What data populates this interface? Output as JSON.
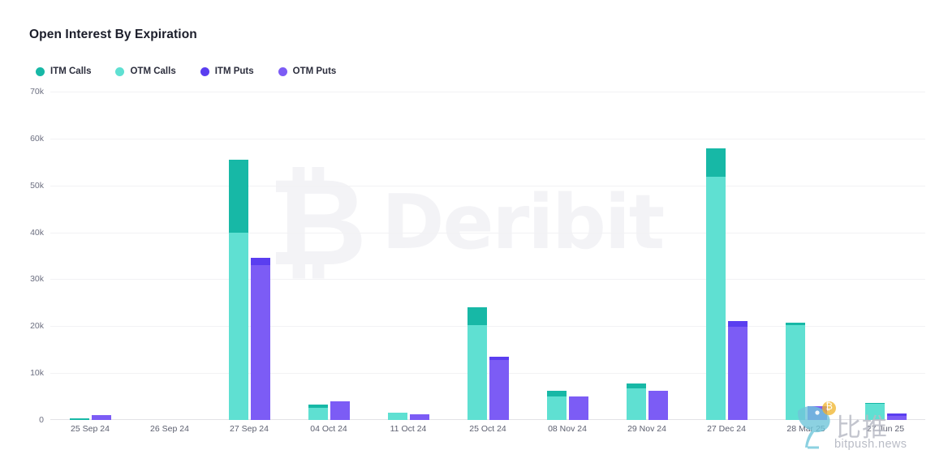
{
  "header": {
    "title": "Open Interest By Expiration"
  },
  "legend": [
    {
      "label": "ITM Calls",
      "color": "#17b8a6"
    },
    {
      "label": "OTM Calls",
      "color": "#5fe0d2"
    },
    {
      "label": "ITM Puts",
      "color": "#5a3ef0"
    },
    {
      "label": "OTM Puts",
      "color": "#7c5cf5"
    }
  ],
  "watermark": {
    "brand": "Deribit",
    "btc_glyph": "₿",
    "bitpush_cn": "比推",
    "bitpush_url": "bitpush.news"
  },
  "chart_data": {
    "type": "bar",
    "title": "Open Interest By Expiration",
    "xlabel": "",
    "ylabel": "",
    "ylim": [
      0,
      70000
    ],
    "ytick_labels": [
      "0",
      "10k",
      "20k",
      "30k",
      "40k",
      "50k",
      "60k",
      "70k"
    ],
    "ytick_values": [
      0,
      10000,
      20000,
      30000,
      40000,
      50000,
      60000,
      70000
    ],
    "grid": true,
    "legend_position": "top-left",
    "stacked": true,
    "grouped": true,
    "categories": [
      "25 Sep 24",
      "26 Sep 24",
      "27 Sep 24",
      "04 Oct 24",
      "11 Oct 24",
      "25 Oct 24",
      "08 Nov 24",
      "29 Nov 24",
      "27 Dec 24",
      "28 Mar 25",
      "27 Jun 25"
    ],
    "series": [
      {
        "name": "OTM Calls",
        "stack": "calls",
        "color": "#5fe0d2",
        "values": [
          0,
          0,
          40000,
          2600,
          1500,
          20300,
          5100,
          6700,
          51800,
          20200,
          3500
        ]
      },
      {
        "name": "ITM Calls",
        "stack": "calls",
        "color": "#17b8a6",
        "values": [
          400,
          0,
          15500,
          700,
          0,
          3700,
          1100,
          1000,
          6100,
          500,
          100
        ]
      },
      {
        "name": "OTM Puts",
        "stack": "puts",
        "color": "#7c5cf5",
        "values": [
          1000,
          0,
          33000,
          4000,
          1200,
          12800,
          5000,
          6200,
          19800,
          3000,
          900
        ]
      },
      {
        "name": "ITM Puts",
        "stack": "puts",
        "color": "#5a3ef0",
        "values": [
          0,
          0,
          1500,
          0,
          0,
          700,
          0,
          0,
          1300,
          0,
          400
        ]
      }
    ]
  }
}
